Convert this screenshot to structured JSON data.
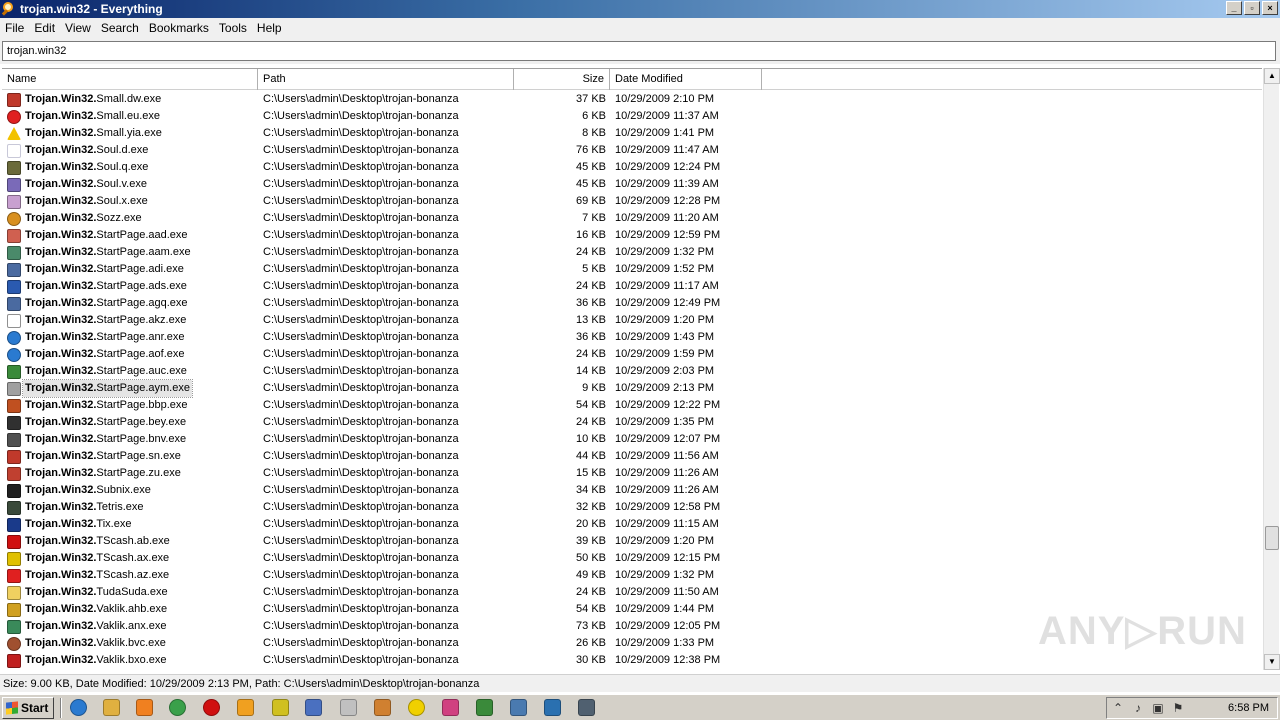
{
  "window": {
    "title": "trojan.win32 - Everything",
    "buttons": [
      "_",
      "▫",
      "×"
    ]
  },
  "menu": [
    "File",
    "Edit",
    "View",
    "Search",
    "Bookmarks",
    "Tools",
    "Help"
  ],
  "search": {
    "value": "trojan.win32"
  },
  "columns": {
    "name": "Name",
    "path": "Path",
    "size": "Size",
    "date": "Date Modified"
  },
  "files": [
    {
      "bold": "Trojan.Win32.",
      "rest": "Small.dw.exe",
      "path": "C:\\Users\\admin\\Desktop\\trojan-bonanza",
      "size": "37 KB",
      "date": "10/29/2009 2:10 PM",
      "icon": "figure-icon",
      "color": "#c0392b"
    },
    {
      "bold": "Trojan.Win32.",
      "rest": "Small.eu.exe",
      "path": "C:\\Users\\admin\\Desktop\\trojan-bonanza",
      "size": "6 KB",
      "date": "10/29/2009 11:37 AM",
      "icon": "error-icon",
      "color": "#e02020"
    },
    {
      "bold": "Trojan.Win32.",
      "rest": "Small.yia.exe",
      "path": "C:\\Users\\admin\\Desktop\\trojan-bonanza",
      "size": "8 KB",
      "date": "10/29/2009 1:41 PM",
      "icon": "warning-icon",
      "color": "#f2c200"
    },
    {
      "bold": "Trojan.Win32.",
      "rest": "Soul.d.exe",
      "path": "C:\\Users\\admin\\Desktop\\trojan-bonanza",
      "size": "76 KB",
      "date": "10/29/2009 11:47 AM",
      "icon": "blank-icon",
      "color": "#c8c8d8"
    },
    {
      "bold": "Trojan.Win32.",
      "rest": "Soul.q.exe",
      "path": "C:\\Users\\admin\\Desktop\\trojan-bonanza",
      "size": "45 KB",
      "date": "10/29/2009 12:24 PM",
      "icon": "people-icon",
      "color": "#6a6a3a"
    },
    {
      "bold": "Trojan.Win32.",
      "rest": "Soul.v.exe",
      "path": "C:\\Users\\admin\\Desktop\\trojan-bonanza",
      "size": "45 KB",
      "date": "10/29/2009 11:39 AM",
      "icon": "image-icon",
      "color": "#7a6ab8"
    },
    {
      "bold": "Trojan.Win32.",
      "rest": "Soul.x.exe",
      "path": "C:\\Users\\admin\\Desktop\\trojan-bonanza",
      "size": "69 KB",
      "date": "10/29/2009 12:28 PM",
      "icon": "blank-purple-icon",
      "color": "#c8a0d0"
    },
    {
      "bold": "Trojan.Win32.",
      "rest": "Sozz.exe",
      "path": "C:\\Users\\admin\\Desktop\\trojan-bonanza",
      "size": "7 KB",
      "date": "10/29/2009 11:20 AM",
      "icon": "face-icon",
      "color": "#d89020"
    },
    {
      "bold": "Trojan.Win32.",
      "rest": "StartPage.aad.exe",
      "path": "C:\\Users\\admin\\Desktop\\trojan-bonanza",
      "size": "16 KB",
      "date": "10/29/2009 12:59 PM",
      "icon": "photo-icon",
      "color": "#d06050"
    },
    {
      "bold": "Trojan.Win32.",
      "rest": "StartPage.aam.exe",
      "path": "C:\\Users\\admin\\Desktop\\trojan-bonanza",
      "size": "24 KB",
      "date": "10/29/2009 1:32 PM",
      "icon": "setup-icon",
      "color": "#4a8a6a"
    },
    {
      "bold": "Trojan.Win32.",
      "rest": "StartPage.adi.exe",
      "path": "C:\\Users\\admin\\Desktop\\trojan-bonanza",
      "size": "5 KB",
      "date": "10/29/2009 1:52 PM",
      "icon": "installer-icon",
      "color": "#4a6aa0"
    },
    {
      "bold": "Trojan.Win32.",
      "rest": "StartPage.ads.exe",
      "path": "C:\\Users\\admin\\Desktop\\trojan-bonanza",
      "size": "24 KB",
      "date": "10/29/2009 11:17 AM",
      "icon": "globe-monitor-icon",
      "color": "#2a5ab0"
    },
    {
      "bold": "Trojan.Win32.",
      "rest": "StartPage.agq.exe",
      "path": "C:\\Users\\admin\\Desktop\\trojan-bonanza",
      "size": "36 KB",
      "date": "10/29/2009 12:49 PM",
      "icon": "installer-icon",
      "color": "#4a6aa0"
    },
    {
      "bold": "Trojan.Win32.",
      "rest": "StartPage.akz.exe",
      "path": "C:\\Users\\admin\\Desktop\\trojan-bonanza",
      "size": "13 KB",
      "date": "10/29/2009 1:20 PM",
      "icon": "document-icon",
      "color": "#909090"
    },
    {
      "bold": "Trojan.Win32.",
      "rest": "StartPage.anr.exe",
      "path": "C:\\Users\\admin\\Desktop\\trojan-bonanza",
      "size": "36 KB",
      "date": "10/29/2009 1:43 PM",
      "icon": "ie-icon",
      "color": "#2a7ad0"
    },
    {
      "bold": "Trojan.Win32.",
      "rest": "StartPage.aof.exe",
      "path": "C:\\Users\\admin\\Desktop\\trojan-bonanza",
      "size": "24 KB",
      "date": "10/29/2009 1:59 PM",
      "icon": "ie-icon",
      "color": "#2a7ad0"
    },
    {
      "bold": "Trojan.Win32.",
      "rest": "StartPage.auc.exe",
      "path": "C:\\Users\\admin\\Desktop\\trojan-bonanza",
      "size": "14 KB",
      "date": "10/29/2009 2:03 PM",
      "icon": "spreadsheet-icon",
      "color": "#3a8a3a"
    },
    {
      "bold": "Trojan.Win32.",
      "rest": "StartPage.aym.exe",
      "path": "C:\\Users\\admin\\Desktop\\trojan-bonanza",
      "size": "9 KB",
      "date": "10/29/2009 2:13 PM",
      "icon": "window-icon",
      "color": "#a0a0a0",
      "selected": true
    },
    {
      "bold": "Trojan.Win32.",
      "rest": "StartPage.bbp.exe",
      "path": "C:\\Users\\admin\\Desktop\\trojan-bonanza",
      "size": "54 KB",
      "date": "10/29/2009 12:22 PM",
      "icon": "java-icon",
      "color": "#c05020"
    },
    {
      "bold": "Trojan.Win32.",
      "rest": "StartPage.bey.exe",
      "path": "C:\\Users\\admin\\Desktop\\trojan-bonanza",
      "size": "24 KB",
      "date": "10/29/2009 1:35 PM",
      "icon": "floppy-icon",
      "color": "#303030"
    },
    {
      "bold": "Trojan.Win32.",
      "rest": "StartPage.bnv.exe",
      "path": "C:\\Users\\admin\\Desktop\\trojan-bonanza",
      "size": "10 KB",
      "date": "10/29/2009 12:07 PM",
      "icon": "disk-icon",
      "color": "#505050"
    },
    {
      "bold": "Trojan.Win32.",
      "rest": "StartPage.sn.exe",
      "path": "C:\\Users\\admin\\Desktop\\trojan-bonanza",
      "size": "44 KB",
      "date": "10/29/2009 11:56 AM",
      "icon": "figure-icon",
      "color": "#c0392b"
    },
    {
      "bold": "Trojan.Win32.",
      "rest": "StartPage.zu.exe",
      "path": "C:\\Users\\admin\\Desktop\\trojan-bonanza",
      "size": "15 KB",
      "date": "10/29/2009 11:26 AM",
      "icon": "installer-box-icon",
      "color": "#c04030"
    },
    {
      "bold": "Trojan.Win32.",
      "rest": "Subnix.exe",
      "path": "C:\\Users\\admin\\Desktop\\trojan-bonanza",
      "size": "34 KB",
      "date": "10/29/2009 11:26 AM",
      "icon": "monitor-icon",
      "color": "#202020"
    },
    {
      "bold": "Trojan.Win32.",
      "rest": "Tetris.exe",
      "path": "C:\\Users\\admin\\Desktop\\trojan-bonanza",
      "size": "32 KB",
      "date": "10/29/2009 12:58 PM",
      "icon": "tetris-icon",
      "color": "#3a4a3a"
    },
    {
      "bold": "Trojan.Win32.",
      "rest": "Tix.exe",
      "path": "C:\\Users\\admin\\Desktop\\trojan-bonanza",
      "size": "20 KB",
      "date": "10/29/2009 11:15 AM",
      "icon": "grid-icon",
      "color": "#1a3a8a"
    },
    {
      "bold": "Trojan.Win32.",
      "rest": "TScash.ab.exe",
      "path": "C:\\Users\\admin\\Desktop\\trojan-bonanza",
      "size": "39 KB",
      "date": "10/29/2009 1:20 PM",
      "icon": "heart-icon",
      "color": "#d01010"
    },
    {
      "bold": "Trojan.Win32.",
      "rest": "TScash.ax.exe",
      "path": "C:\\Users\\admin\\Desktop\\trojan-bonanza",
      "size": "50 KB",
      "date": "10/29/2009 12:15 PM",
      "icon": "lightning-icon",
      "color": "#e0c000"
    },
    {
      "bold": "Trojan.Win32.",
      "rest": "TScash.az.exe",
      "path": "C:\\Users\\admin\\Desktop\\trojan-bonanza",
      "size": "49 KB",
      "date": "10/29/2009 1:32 PM",
      "icon": "red-box-icon",
      "color": "#e02020"
    },
    {
      "bold": "Trojan.Win32.",
      "rest": "TudaSuda.exe",
      "path": "C:\\Users\\admin\\Desktop\\trojan-bonanza",
      "size": "24 KB",
      "date": "10/29/2009 11:50 AM",
      "icon": "folder-icon",
      "color": "#f0d060"
    },
    {
      "bold": "Trojan.Win32.",
      "rest": "Vaklik.ahb.exe",
      "path": "C:\\Users\\admin\\Desktop\\trojan-bonanza",
      "size": "54 KB",
      "date": "10/29/2009 1:44 PM",
      "icon": "bag-icon",
      "color": "#d0a020"
    },
    {
      "bold": "Trojan.Win32.",
      "rest": "Vaklik.anx.exe",
      "path": "C:\\Users\\admin\\Desktop\\trojan-bonanza",
      "size": "73 KB",
      "date": "10/29/2009 12:05 PM",
      "icon": "users-icon",
      "color": "#3a8a5a"
    },
    {
      "bold": "Trojan.Win32.",
      "rest": "Vaklik.bvc.exe",
      "path": "C:\\Users\\admin\\Desktop\\trojan-bonanza",
      "size": "26 KB",
      "date": "10/29/2009 1:33 PM",
      "icon": "face-icon",
      "color": "#a05030"
    },
    {
      "bold": "Trojan.Win32.",
      "rest": "Vaklik.bxo.exe",
      "path": "C:\\Users\\admin\\Desktop\\trojan-bonanza",
      "size": "30 KB",
      "date": "10/29/2009 12:38 PM",
      "icon": "bow-icon",
      "color": "#c02020"
    }
  ],
  "status": "Size: 9.00 KB, Date Modified: 10/29/2009 2:13 PM, Path: C:\\Users\\admin\\Desktop\\trojan-bonanza",
  "taskbar": {
    "start_label": "Start",
    "apps": [
      {
        "name": "ie-icon",
        "color": "#2a7ad0"
      },
      {
        "name": "explorer-icon",
        "color": "#e0b040"
      },
      {
        "name": "media-player-icon",
        "color": "#f08020"
      },
      {
        "name": "chrome-icon",
        "color": "#3aa04a"
      },
      {
        "name": "opera-icon",
        "color": "#d01010"
      },
      {
        "name": "everything-icon",
        "color": "#f0a020"
      },
      {
        "name": "app-icon",
        "color": "#d0c020"
      },
      {
        "name": "network-icon",
        "color": "#4a70c0"
      },
      {
        "name": "hand-icon",
        "color": "#c0c0c0"
      },
      {
        "name": "archive-icon",
        "color": "#d08030"
      },
      {
        "name": "radiation-icon",
        "color": "#f0d000"
      },
      {
        "name": "flower-icon",
        "color": "#d04080"
      },
      {
        "name": "battery-icon",
        "color": "#3a8a3a"
      },
      {
        "name": "window-app-icon",
        "color": "#4a7ab0"
      },
      {
        "name": "chart-app-icon",
        "color": "#2a70b0"
      },
      {
        "name": "monitor-app-icon",
        "color": "#506070"
      }
    ],
    "clock": "6:58 PM"
  },
  "watermark": "ANY▷RUN"
}
